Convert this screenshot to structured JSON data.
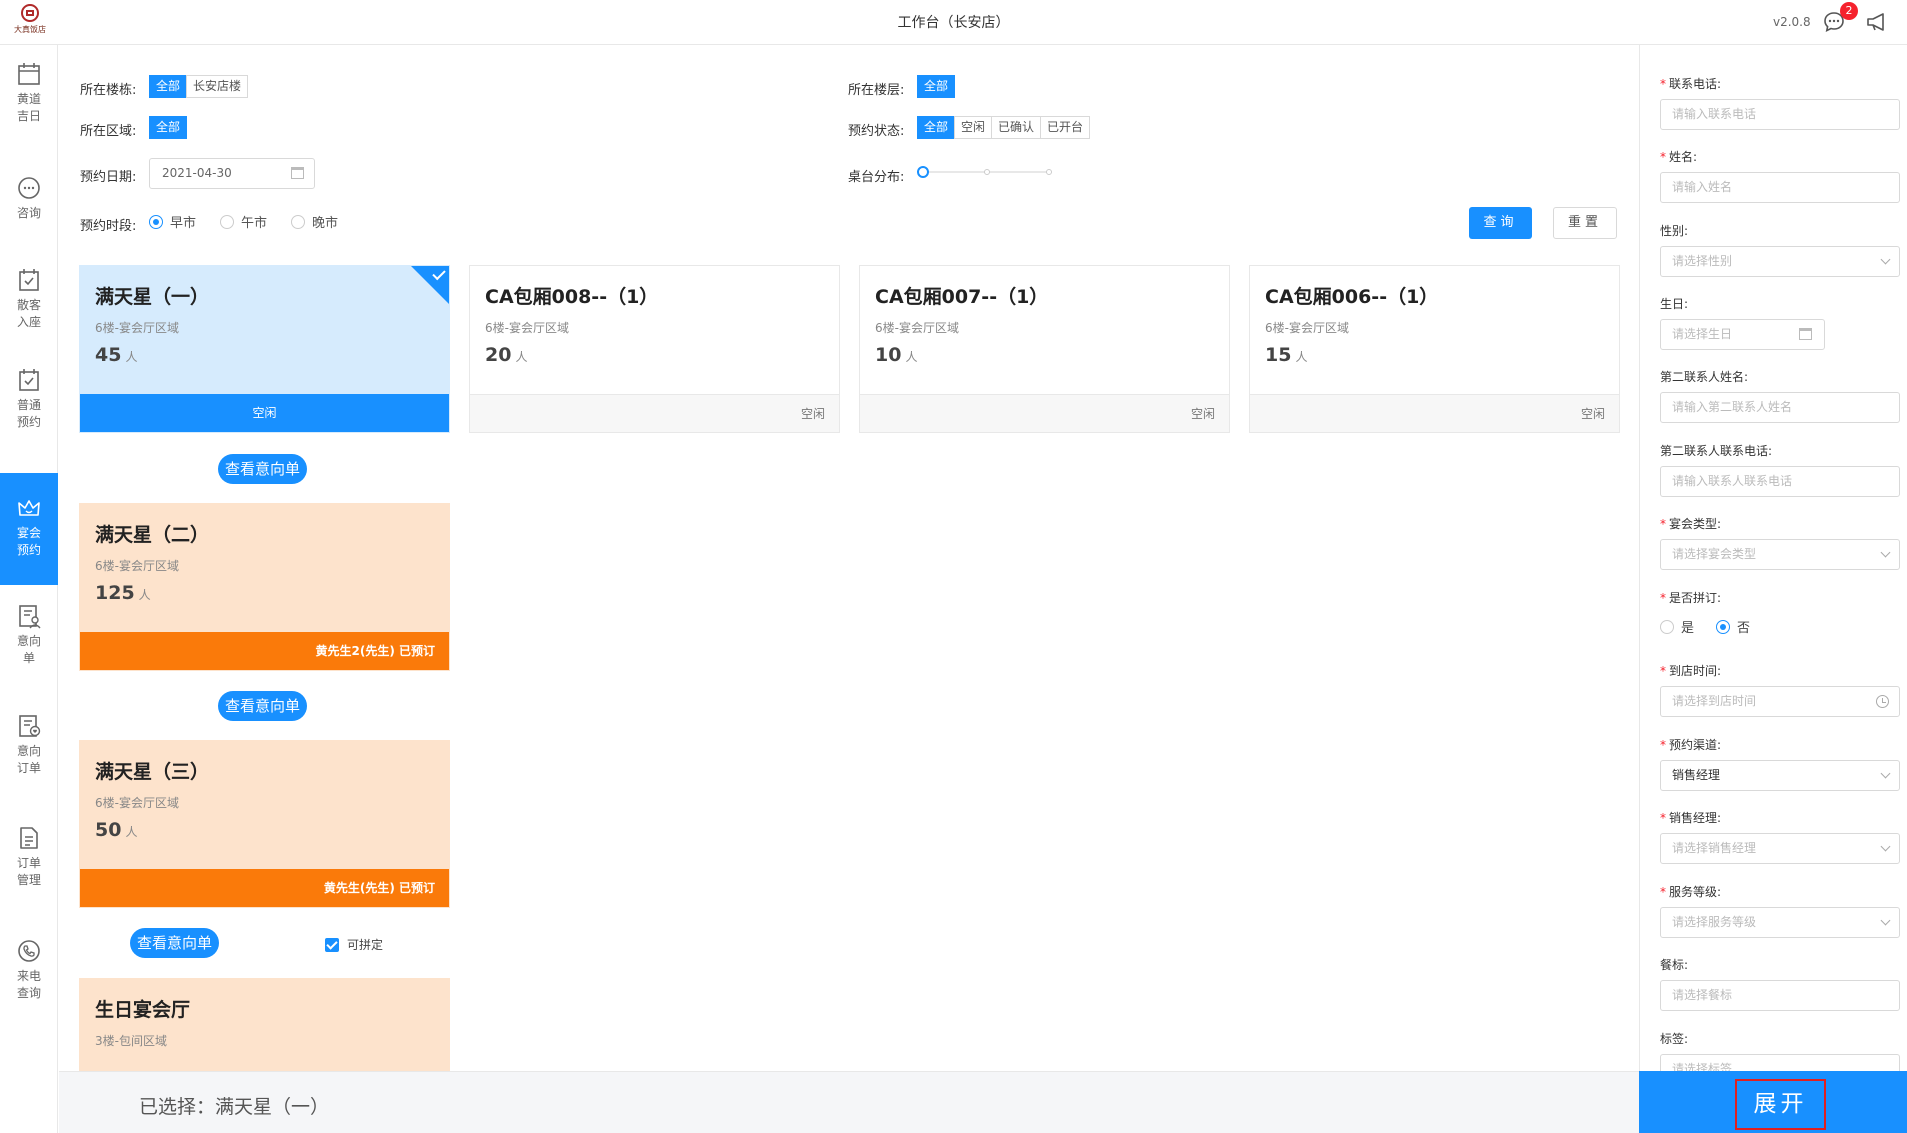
{
  "header": {
    "logo_text": "大真饭店",
    "title": "工作台（长安店）",
    "version": "v2.0.8",
    "message_count": "2"
  },
  "nav": {
    "items": [
      {
        "label": "黄道吉日",
        "icon": "calendar-icon"
      },
      {
        "label": "咨询",
        "icon": "chat-icon"
      },
      {
        "label": "散客入座",
        "icon": "calendar-check-icon"
      },
      {
        "label": "普通预约",
        "icon": "calendar-check-icon"
      },
      {
        "label": "宴会预约",
        "icon": "crown-icon",
        "active": true
      },
      {
        "label": "意向单",
        "icon": "document-user-icon"
      },
      {
        "label": "意向订单",
        "icon": "document-heart-icon"
      },
      {
        "label": "订单管理",
        "icon": "document-icon"
      },
      {
        "label": "来电查询",
        "icon": "phone-icon"
      }
    ]
  },
  "filters": {
    "building": {
      "label": "所在楼栋:",
      "options": [
        "全部",
        "长安店楼"
      ],
      "selected": "全部"
    },
    "floor": {
      "label": "所在楼层:",
      "options": [
        "全部"
      ],
      "selected": "全部"
    },
    "region": {
      "label": "所在区域:",
      "options": [
        "全部"
      ],
      "selected": "全部"
    },
    "status": {
      "label": "预约状态:",
      "options": [
        "全部",
        "空闲",
        "已确认",
        "已开台"
      ],
      "selected": "全部"
    },
    "date": {
      "label": "预约日期:",
      "value": "2021-04-30"
    },
    "table_dist": {
      "label": "桌台分布:"
    },
    "period": {
      "label": "预约时段:",
      "options": [
        "早市",
        "午市",
        "晚市"
      ],
      "selected": "早市"
    },
    "query_label": "查询",
    "reset_label": "重置"
  },
  "cards": [
    {
      "name": "满天星（一）",
      "area": "6楼-宴会厅区域",
      "capacity": "45",
      "unit": "人",
      "footer": "空闲",
      "state": "selected"
    },
    {
      "name": "CA包厢008--（1）",
      "area": "6楼-宴会厅区域",
      "capacity": "20",
      "unit": "人",
      "footer": "空闲",
      "state": "free"
    },
    {
      "name": "CA包厢007--（1）",
      "area": "6楼-宴会厅区域",
      "capacity": "10",
      "unit": "人",
      "footer": "空闲",
      "state": "free"
    },
    {
      "name": "CA包厢006--（1）",
      "area": "6楼-宴会厅区域",
      "capacity": "15",
      "unit": "人",
      "footer": "空闲",
      "state": "free"
    },
    {
      "name": "满天星（二）",
      "area": "6楼-宴会厅区域",
      "capacity": "125",
      "unit": "人",
      "footer": "黄先生2(先生) 已预订",
      "state": "booked"
    },
    {
      "name": "满天星（三）",
      "area": "6楼-宴会厅区域",
      "capacity": "50",
      "unit": "人",
      "footer": "黄先生(先生) 已预订",
      "state": "booked"
    },
    {
      "name": "生日宴会厅",
      "area": "3楼-包间区域",
      "state": "booked"
    }
  ],
  "view_intent_label": "查看意向单",
  "combinable_label": "可拼定",
  "bottom": {
    "selected_text": "已选择：满天星（一）"
  },
  "form": {
    "fields": [
      {
        "label": "联系电话:",
        "required": true,
        "placeholder": "请输入联系电话",
        "kind": "text"
      },
      {
        "label": "姓名:",
        "required": true,
        "placeholder": "请输入姓名",
        "kind": "text"
      },
      {
        "label": "性别:",
        "required": false,
        "placeholder": "请选择性别",
        "kind": "select"
      },
      {
        "label": "生日:",
        "required": false,
        "placeholder": "请选择生日",
        "kind": "date"
      },
      {
        "label": "第二联系人姓名:",
        "required": false,
        "placeholder": "请输入第二联系人姓名",
        "kind": "text"
      },
      {
        "label": "第二联系人联系电话:",
        "required": false,
        "placeholder": "请输入联系人联系电话",
        "kind": "text"
      },
      {
        "label": "宴会类型:",
        "required": true,
        "placeholder": "请选择宴会类型",
        "kind": "select"
      },
      {
        "label": "是否拼订:",
        "required": true,
        "kind": "radio",
        "options": [
          "是",
          "否"
        ],
        "selected": "否"
      },
      {
        "label": "到店时间:",
        "required": true,
        "placeholder": "请选择到店时间",
        "kind": "time"
      },
      {
        "label": "预约渠道:",
        "required": true,
        "value": "销售经理",
        "kind": "select"
      },
      {
        "label": "销售经理:",
        "required": true,
        "placeholder": "请选择销售经理",
        "kind": "select"
      },
      {
        "label": "服务等级:",
        "required": true,
        "placeholder": "请选择服务等级",
        "kind": "select"
      },
      {
        "label": "餐标:",
        "required": false,
        "placeholder": "请选择餐标",
        "kind": "text"
      },
      {
        "label": "标签:",
        "required": false,
        "placeholder": "请选择标签",
        "kind": "text"
      }
    ],
    "expand_label": "展开"
  }
}
